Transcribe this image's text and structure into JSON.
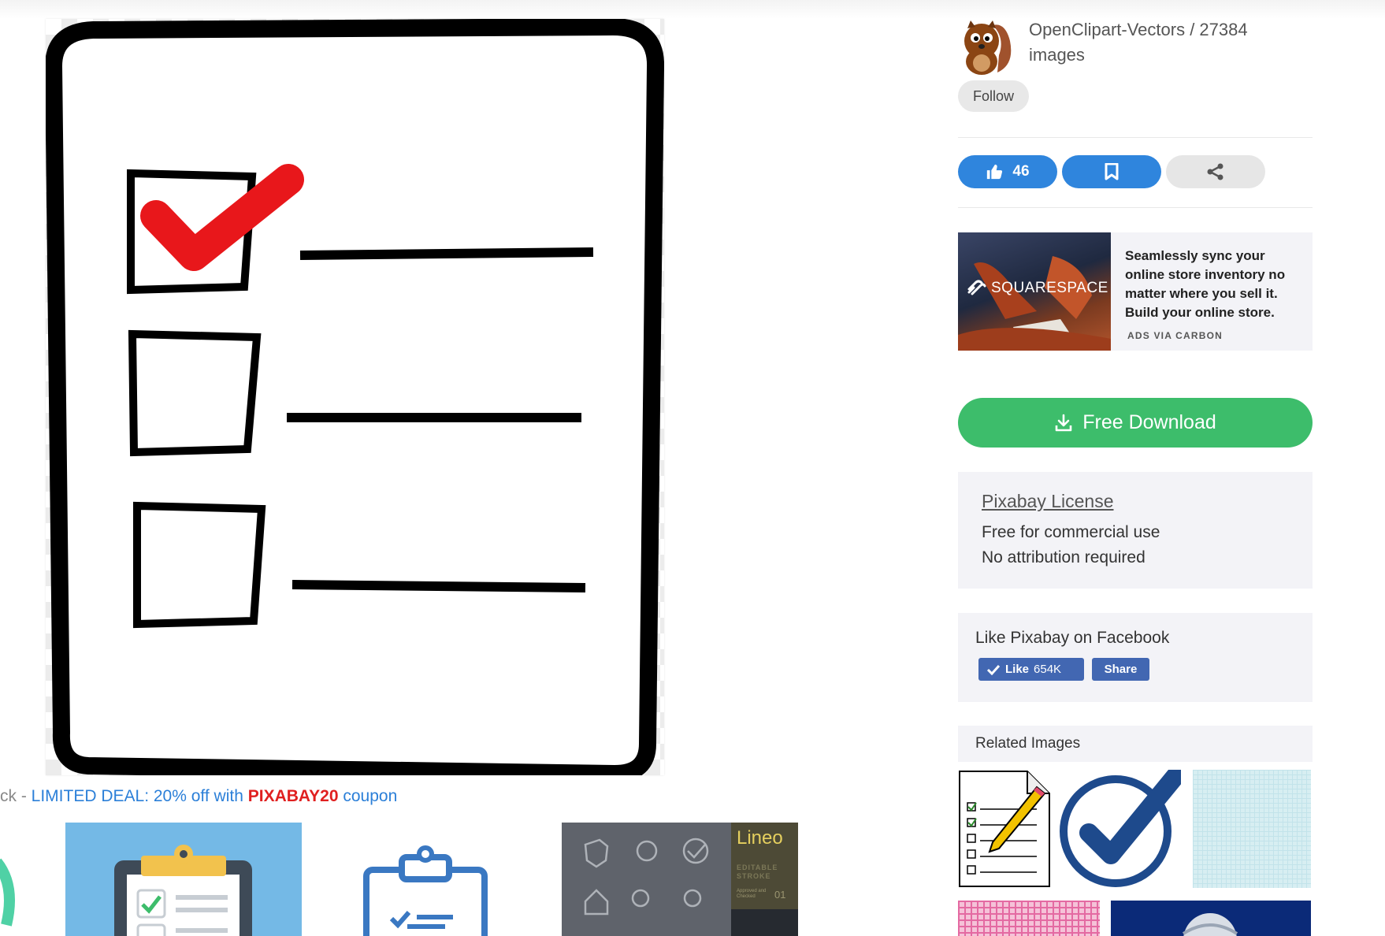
{
  "promo": {
    "prefix": "ck - ",
    "deal": "LIMITED DEAL: 20% off with ",
    "code": "PIXABAY20",
    "suffix": " coupon"
  },
  "bottom_thumb_3": {
    "brand": "Lineo",
    "caption": "EDITABLE STROKE",
    "sub": "Approved and Checked",
    "num": "01"
  },
  "author": {
    "name": "OpenClipart-Vectors / 27384 images",
    "follow_label": "Follow"
  },
  "actions": {
    "like_count": "46"
  },
  "ad": {
    "brand": "SQUARESPACE",
    "text": "Seamlessly sync your online store inventory no matter where you sell it. Build your online store.",
    "via": "ADS VIA CARBON"
  },
  "download": {
    "label": "Free Download"
  },
  "license": {
    "link": "Pixabay License",
    "line1": "Free for commercial use",
    "line2": "No attribution required"
  },
  "facebook": {
    "title": "Like Pixabay on Facebook",
    "like_label": "Like",
    "like_count": "654K",
    "share_label": "Share"
  },
  "related": {
    "title": "Related Images"
  },
  "colors": {
    "accent_blue": "#2f85dd",
    "download_green": "#3dbd6b",
    "promo_red": "#e02020",
    "checkmark_red": "#e8171b"
  }
}
